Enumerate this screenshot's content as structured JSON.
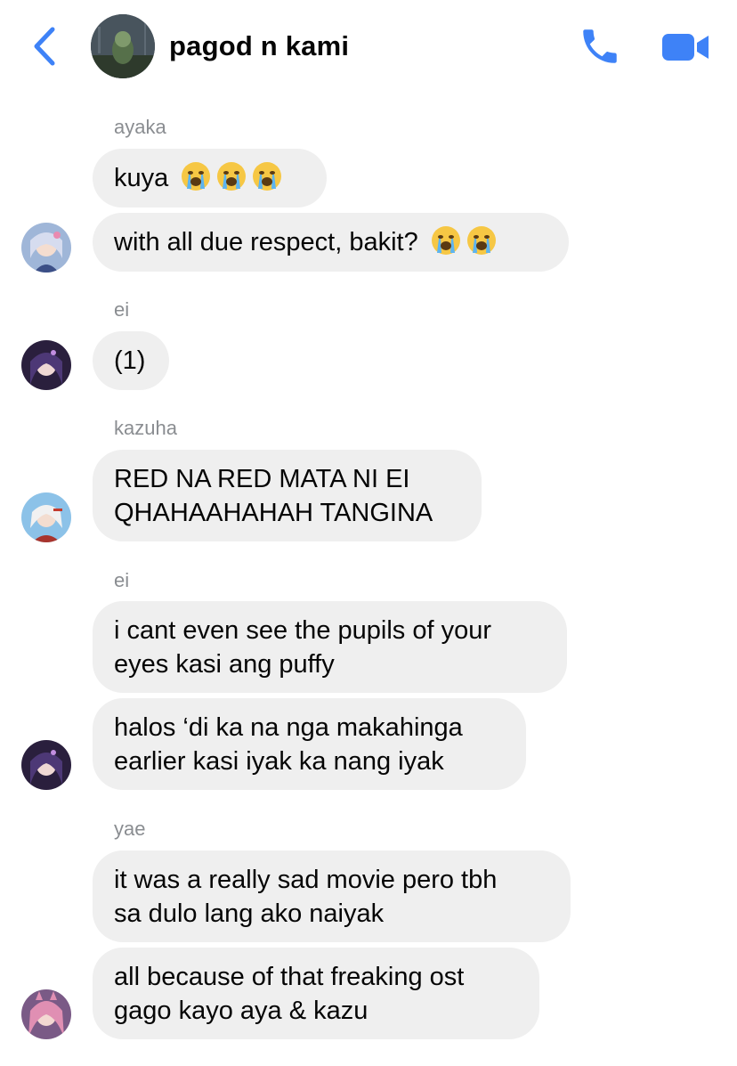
{
  "header": {
    "title": "pagod n kami",
    "back_icon": "chevron-left-icon",
    "call_icon": "phone-icon",
    "video_icon": "video-camera-icon",
    "accent_color": "#3e82f7"
  },
  "messages": [
    {
      "sender": "ayaka"
    },
    {
      "bubble_1": "kuya",
      "bubble_1_emoji_count": 3
    },
    {
      "bubble_2": "with all due respect, bakit?",
      "bubble_2_emoji_count": 2
    },
    {
      "sender": "ei"
    },
    {
      "bubble": "(1)"
    },
    {
      "sender": "kazuha"
    },
    {
      "line_1": "RED NA RED MATA NI EI",
      "line_2": "QHAHAAHAHAH TANGINA"
    },
    {
      "sender": "ei"
    },
    {
      "line_1": "i cant even see the pupils of your",
      "line_2": "eyes kasi ang puffy"
    },
    {
      "line_1": "halos ‘di ka na nga makahinga",
      "line_2": "earlier kasi iyak ka nang iyak"
    },
    {
      "sender": "yae"
    },
    {
      "line_1": "it was a really sad movie pero tbh",
      "line_2": "sa dulo lang ako naiyak"
    },
    {
      "line_1": "all because of that freaking ost",
      "line_2": "gago kayo aya & kazu"
    }
  ],
  "colors": {
    "bubble_bg": "#efefef",
    "sender_name": "#8a8d91",
    "emoji_face": "#f6c744"
  }
}
